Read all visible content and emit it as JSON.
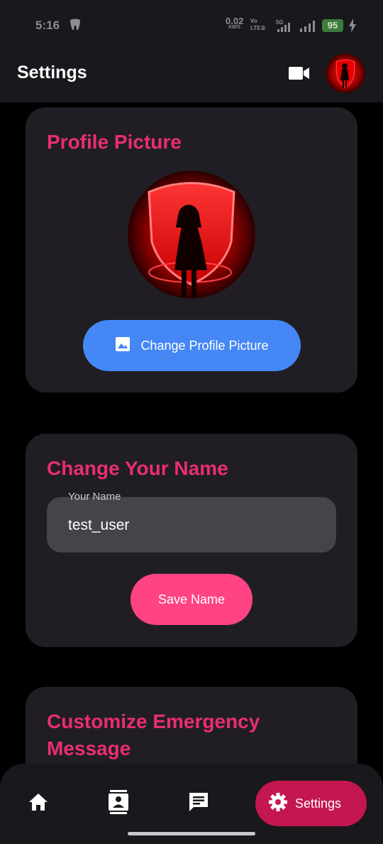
{
  "status_bar": {
    "time": "5:16",
    "net_speed_value": "0.02",
    "net_speed_unit": "KB/S",
    "volte_top": "Vo",
    "volte_bottom": "LTE①",
    "network": "5G",
    "battery": "95"
  },
  "app_bar": {
    "title": "Settings"
  },
  "profile_card": {
    "title": "Profile Picture",
    "change_button_label": "Change Profile Picture"
  },
  "name_card": {
    "title": "Change Your Name",
    "field_label": "Your Name",
    "field_value": "test_user",
    "save_button_label": "Save Name"
  },
  "emergency_card": {
    "title": "Customize Emergency Message"
  },
  "bottom_nav": {
    "items": [
      {
        "icon": "home-icon"
      },
      {
        "icon": "contacts-icon"
      },
      {
        "icon": "chat-icon"
      },
      {
        "icon": "gear-icon",
        "label": "Settings",
        "active": true
      }
    ]
  },
  "colors": {
    "accent_title": "#ea2d71",
    "primary_button": "#4487f5",
    "save_button": "#ff4383",
    "active_nav": "#c4164f"
  }
}
